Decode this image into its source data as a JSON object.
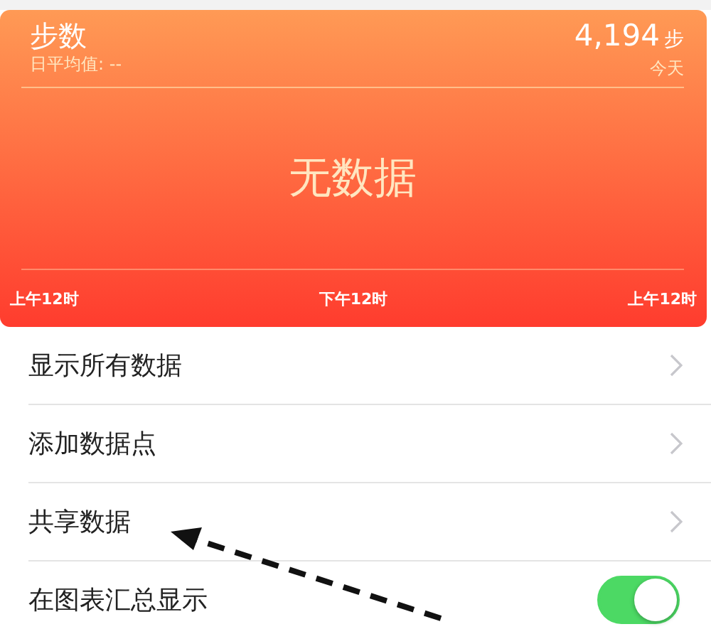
{
  "chart": {
    "title": "步数",
    "average": "日平均值: --",
    "value": "4,194",
    "unit": "步",
    "period": "今天",
    "empty_message": "无数据",
    "x_labels": [
      "上午12时",
      "下午12时",
      "上午12时"
    ]
  },
  "rows": [
    {
      "kind": "link",
      "label": "显示所有数据"
    },
    {
      "kind": "link",
      "label": "添加数据点"
    },
    {
      "kind": "link",
      "label": "共享数据"
    },
    {
      "kind": "toggle",
      "label": "在图表汇总显示",
      "on": true
    }
  ]
}
